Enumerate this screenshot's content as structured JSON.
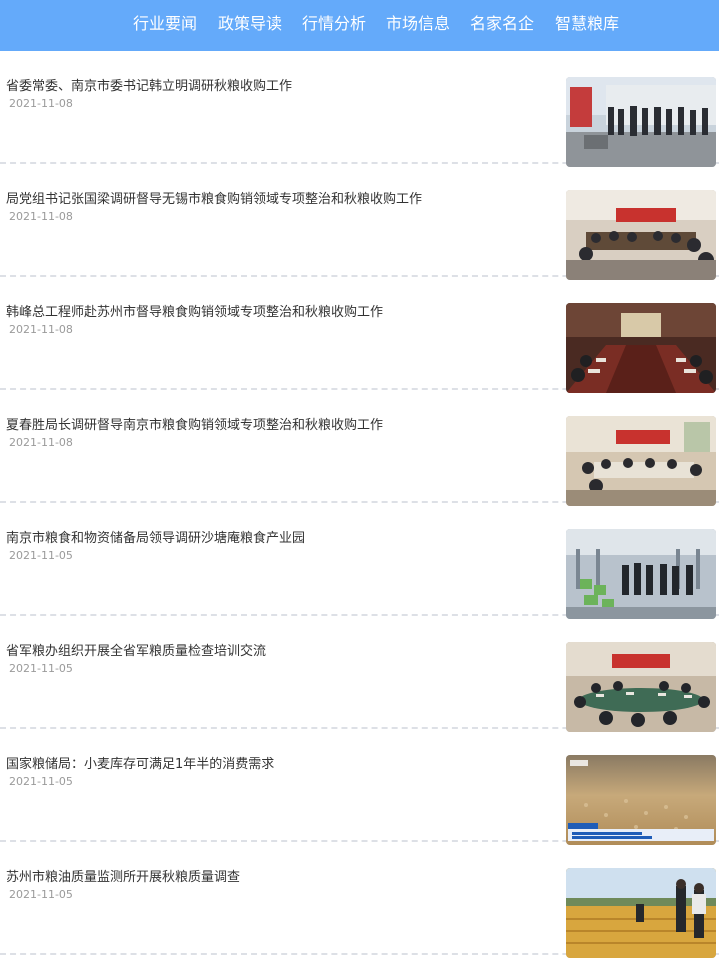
{
  "nav": {
    "items": [
      {
        "label": "行业要闻"
      },
      {
        "label": "政策导读"
      },
      {
        "label": "行情分析"
      },
      {
        "label": "市场信息"
      },
      {
        "label": "名家名企"
      },
      {
        "label": "智慧粮库"
      }
    ],
    "background": "#64aafa"
  },
  "news": [
    {
      "title": "省委常委、南京市委书记韩立明调研秋粮收购工作",
      "date": "2021-11-08",
      "thumb": "officials-visit-warehouse-photo"
    },
    {
      "title": "局党组书记张国梁调研督导无锡市粮食购销领域专项整治和秋粮收购工作",
      "date": "2021-11-08",
      "thumb": "meeting-room-photo"
    },
    {
      "title": "韩峰总工程师赴苏州市督导粮食购销领域专项整治和秋粮收购工作",
      "date": "2021-11-08",
      "thumb": "conference-table-photo"
    },
    {
      "title": "夏春胜局长调研督导南京市粮食购销领域专项整治和秋粮收购工作",
      "date": "2021-11-08",
      "thumb": "meeting-hall-photo"
    },
    {
      "title": "南京市粮食和物资储备局领导调研沙塘庵粮食产业园",
      "date": "2021-11-05",
      "thumb": "factory-visit-photo"
    },
    {
      "title": "省军粮办组织开展全省军粮质量检查培训交流",
      "date": "2021-11-05",
      "thumb": "training-meeting-photo"
    },
    {
      "title": "国家粮储局：小麦库存可满足1年半的消费需求",
      "date": "2021-11-05",
      "thumb": "wheat-grain-tv-photo"
    },
    {
      "title": "苏州市粮油质量监测所开展秋粮质量调查",
      "date": "2021-11-05",
      "thumb": "rice-field-photo"
    }
  ]
}
